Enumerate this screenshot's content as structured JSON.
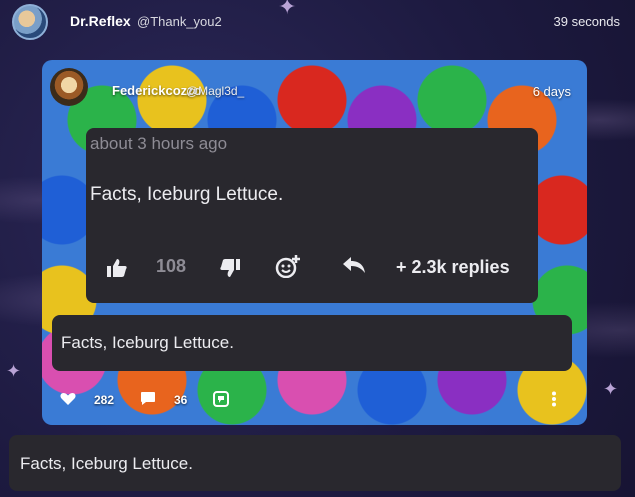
{
  "header": {
    "name": "Dr.Reflex",
    "handle": "@Thank_you2",
    "time": "39 seconds"
  },
  "post": {
    "author": "Federickcozzo",
    "handle": "@Magl3d_",
    "time": "6 days",
    "comment": {
      "time_ago": "about 3 hours ago",
      "text": "Facts, Iceburg Lettuce.",
      "likes": "108",
      "replies_label": "+ 2.3k replies"
    },
    "reply_text": "Facts, Iceburg Lettuce.",
    "stats": {
      "hearts": "282",
      "comments": "36"
    }
  },
  "outer_reply": {
    "text": "Facts, Iceburg Lettuce."
  },
  "icons": [
    "sparkle-icon",
    "thumbs-up-icon",
    "thumbs-down-icon",
    "add-reaction-icon",
    "reply-arrow-icon",
    "heart-icon",
    "comment-icon",
    "dislike-icon",
    "more-options-icon"
  ]
}
